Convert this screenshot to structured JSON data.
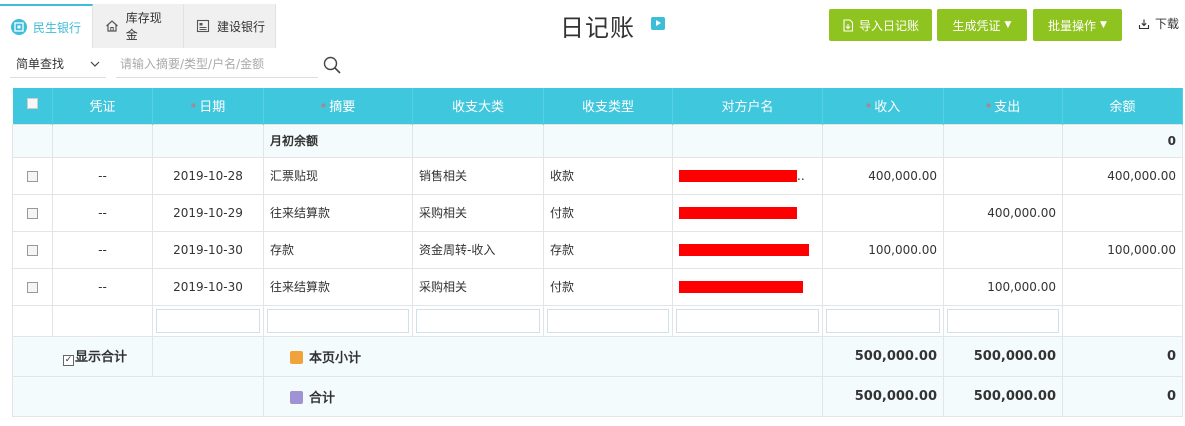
{
  "tabs": [
    {
      "label": "民生银行",
      "icon": "bank-logo-icon",
      "active": true
    },
    {
      "label": "库存现金",
      "icon": "home-icon",
      "active": false
    },
    {
      "label": "建设银行",
      "icon": "bank-card-icon",
      "active": false
    }
  ],
  "header": {
    "title": "日记账",
    "import_label": "导入日记账",
    "generate_label": "生成凭证",
    "batch_label": "批量操作",
    "download_label": "下载"
  },
  "search": {
    "mode": "简单查找",
    "placeholder": "请输入摘要/类型/户名/金额"
  },
  "table": {
    "headers": [
      "凭证",
      "日期",
      "摘要",
      "收支大类",
      "收支类型",
      "对方户名",
      "收入",
      "支出",
      "余额"
    ],
    "opening_label": "月初余额",
    "opening_balance": "0",
    "rows": [
      {
        "voucher": "--",
        "date": "2019-10-28",
        "summary": "汇票贴现",
        "category": "销售相关",
        "type": "收款",
        "counterparty_suffix": "..",
        "income": "400,000.00",
        "expense": "",
        "balance": "400,000.00"
      },
      {
        "voucher": "--",
        "date": "2019-10-29",
        "summary": "往来结算款",
        "category": "采购相关",
        "type": "付款",
        "counterparty_suffix": "",
        "income": "",
        "expense": "400,000.00",
        "balance": ""
      },
      {
        "voucher": "--",
        "date": "2019-10-30",
        "summary": "存款",
        "category": "资金周转-收入",
        "type": "存款",
        "counterparty_suffix": "",
        "income": "100,000.00",
        "expense": "",
        "balance": "100,000.00"
      },
      {
        "voucher": "--",
        "date": "2019-10-30",
        "summary": "往来结算款",
        "category": "采购相关",
        "type": "付款",
        "counterparty_suffix": "",
        "income": "",
        "expense": "100,000.00",
        "balance": ""
      }
    ]
  },
  "summary": {
    "show_total_label": "显示合计",
    "page_subtotal_label": "本页小计",
    "page_subtotal_income": "500,000.00",
    "page_subtotal_expense": "500,000.00",
    "page_subtotal_balance": "0",
    "total_label": "合计",
    "total_income": "500,000.00",
    "total_expense": "500,000.00",
    "total_balance": "0"
  },
  "colors": {
    "accent": "#3fc7dd",
    "button_green": "#8fc31f",
    "required_mark": "#f35a5a",
    "redaction": "#ff0000"
  }
}
